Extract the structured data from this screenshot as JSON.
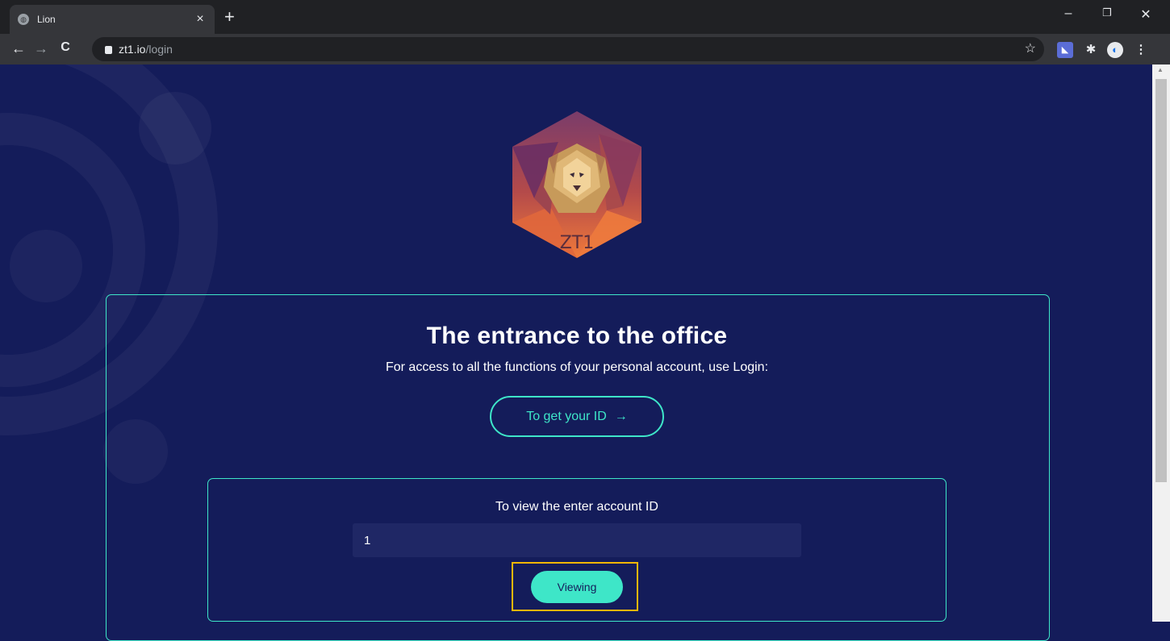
{
  "browser": {
    "tab_title": "Lion",
    "tab_close": "×",
    "new_tab": "+",
    "url_host": "zt1.io",
    "url_path": "/login",
    "window_controls": {
      "minimize": "–",
      "restore": "❐",
      "close": "✕"
    },
    "nav": {
      "back": "←",
      "forward": "→",
      "reload": "C"
    },
    "star": "☆",
    "extensions": {
      "menu": "⋮"
    }
  },
  "logo": {
    "text": "ZT1",
    "icon": "lion-hexagon-logo"
  },
  "login": {
    "heading": "The entrance to the office",
    "subtext": "For access to all the functions of your personal account, use Login:",
    "get_id_label": "To get your ID",
    "get_id_arrow": "→"
  },
  "view": {
    "label": "To view the enter account ID",
    "input_value": "1",
    "button_label": "Viewing"
  },
  "colors": {
    "background": "#141c5a",
    "accent": "#3ee6c8",
    "highlight": "#f2b705"
  }
}
